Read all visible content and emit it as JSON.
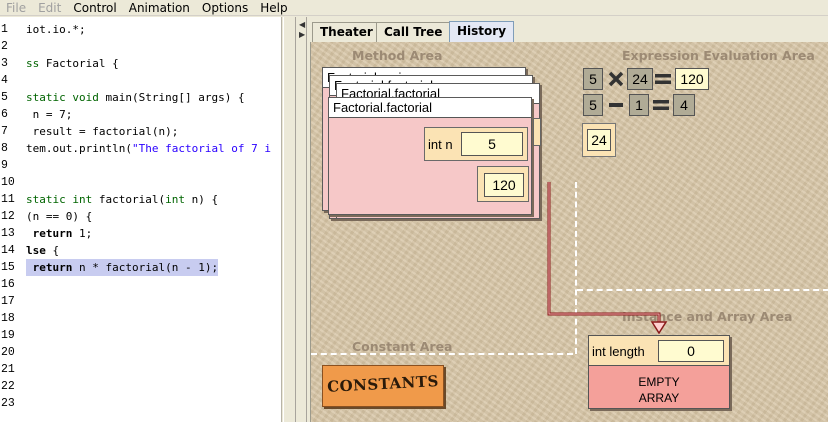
{
  "menubar": {
    "items": [
      {
        "label": "File",
        "enabled": false
      },
      {
        "label": "Edit",
        "enabled": false
      },
      {
        "label": "Control",
        "enabled": true
      },
      {
        "label": "Animation",
        "enabled": true
      },
      {
        "label": "Options",
        "enabled": true
      },
      {
        "label": "Help",
        "enabled": true
      }
    ]
  },
  "editor": {
    "lines": [
      {
        "n": "1",
        "code": "iot.io.*;"
      },
      {
        "n": "2",
        "code": ""
      },
      {
        "n": "3",
        "code": "ss Factorial {"
      },
      {
        "n": "4",
        "code": ""
      },
      {
        "n": "5",
        "code": "static void main(String[] args) {"
      },
      {
        "n": "6",
        "code": " n = 7;"
      },
      {
        "n": "7",
        "code": " result = factorial(n);"
      },
      {
        "n": "8",
        "code": "tem.out.println(\"The factorial of 7 i"
      },
      {
        "n": "9",
        "code": ""
      },
      {
        "n": "10",
        "code": ""
      },
      {
        "n": "11",
        "code": "static int factorial(int n) {"
      },
      {
        "n": "12",
        "code": "(n == 0) {"
      },
      {
        "n": "13",
        "code": " return 1;"
      },
      {
        "n": "14",
        "code": "lse {"
      },
      {
        "n": "15",
        "code": " return n * factorial(n - 1);"
      },
      {
        "n": "16",
        "code": ""
      },
      {
        "n": "17",
        "code": ""
      },
      {
        "n": "18",
        "code": ""
      },
      {
        "n": "19",
        "code": ""
      },
      {
        "n": "20",
        "code": ""
      },
      {
        "n": "21",
        "code": ""
      },
      {
        "n": "22",
        "code": ""
      },
      {
        "n": "23",
        "code": ""
      }
    ],
    "highlighted_line": "15"
  },
  "tabs": [
    {
      "label": "Theater",
      "active": false
    },
    {
      "label": "Call Tree",
      "active": false
    },
    {
      "label": "History",
      "active": true
    }
  ],
  "theater": {
    "method_area_title": "Method Area",
    "expression_area_title": "Expression Evaluation Area",
    "constant_area_title": "Constant Area",
    "instance_area_title": "Instance and Array Area",
    "frames_stack": [
      {
        "title": "Factorial.main"
      },
      {
        "title": "Factorial.factorial"
      },
      {
        "title": "Factorial.factorial"
      }
    ],
    "top_frame": {
      "title": "Factorial.factorial",
      "variable_label": "int n",
      "variable_value": "5",
      "return_value": "120"
    },
    "expression": {
      "row1": {
        "left": "5",
        "op": "×",
        "right": "24",
        "eq": "=",
        "result": "120"
      },
      "row2": {
        "left": "5",
        "op": "−",
        "right": "1",
        "eq": "=",
        "result": "4"
      },
      "pending": "24"
    },
    "constants_label": "CONSTANTS",
    "array": {
      "label": "int length",
      "value": "0",
      "text_line1": "EMPTY",
      "text_line2": "ARRAY"
    }
  },
  "colors": {
    "highlight": "#c8ccf0",
    "frame_body": "#f6c8c8",
    "variable_box": "#fbe3b4",
    "value_box": "#fffbd0",
    "canvas": "#d8c7a8",
    "arrow": "#8a1a1a",
    "constants": "#f09a4a",
    "array_body": "#f4a09a"
  }
}
